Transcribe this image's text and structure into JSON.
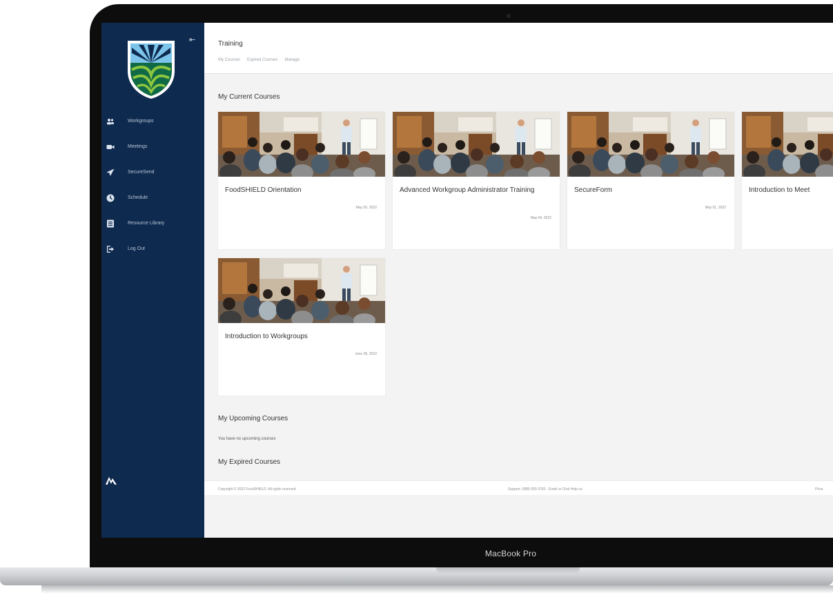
{
  "device": {
    "label": "MacBook Pro"
  },
  "header": {
    "title": "Training",
    "breadcrumb": [
      "My Courses",
      "Expired Courses",
      "Manage"
    ]
  },
  "sidebar": {
    "items": [
      {
        "label": "Workgroups",
        "icon": "group-icon"
      },
      {
        "label": "Meetings",
        "icon": "video-icon"
      },
      {
        "label": "SecureSend",
        "icon": "send-icon"
      },
      {
        "label": "Schedule",
        "icon": "clock-icon"
      },
      {
        "label": "Resource Library",
        "icon": "library-icon"
      },
      {
        "label": "Log Out",
        "icon": "logout-icon"
      }
    ]
  },
  "main": {
    "current_title": "My Current Courses",
    "courses": [
      {
        "title": "FoodSHIELD Orientation",
        "date": "May 20, 2022"
      },
      {
        "title": "Advanced Workgroup Administrator Training",
        "date": "May 04, 2022"
      },
      {
        "title": "SecureForm",
        "date": "May 01, 2022"
      },
      {
        "title": "Introduction to Meet",
        "date": ""
      },
      {
        "title": "Introduction to Workgroups",
        "date": "June 28, 2022"
      }
    ],
    "upcoming_title": "My Upcoming Courses",
    "upcoming_empty": "You have no upcoming courses",
    "expired_title": "My Expired Courses"
  },
  "footer": {
    "copyright": "Copyright © 2022 FoodSHIELD. All rights reserved.",
    "support": "Support: (888) 000-3783 · Email or Chat Help us",
    "right": "Priva"
  },
  "colors": {
    "sidebar": "#0f2a4f",
    "content_bg": "#f3f3f3",
    "card_bg": "#ffffff"
  }
}
